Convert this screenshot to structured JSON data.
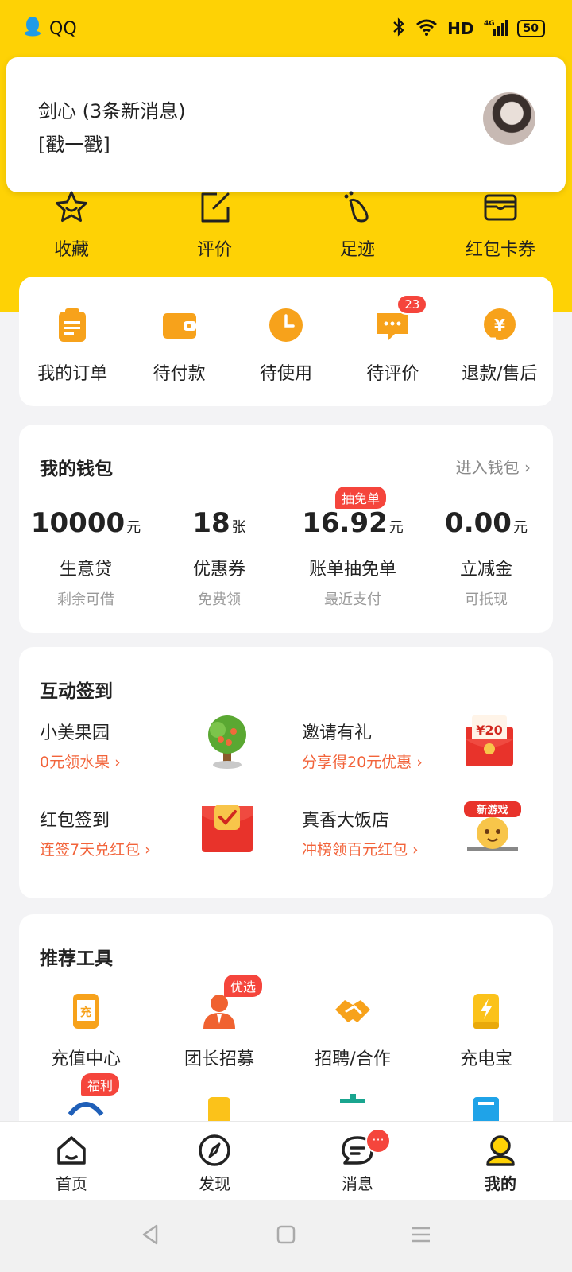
{
  "status_bar": {
    "app": "QQ",
    "network": "HD",
    "signal": "4G",
    "battery": "50"
  },
  "notification": {
    "title": "剑心 (3条新消息)",
    "body": "[戳一戳]"
  },
  "quick_actions": [
    {
      "label": "收藏",
      "icon": "star-icon"
    },
    {
      "label": "评价",
      "icon": "edit-icon"
    },
    {
      "label": "足迹",
      "icon": "footprint-icon"
    },
    {
      "label": "红包卡券",
      "icon": "wallet-card-icon"
    }
  ],
  "orders": [
    {
      "label": "我的订单",
      "icon": "clipboard-icon"
    },
    {
      "label": "待付款",
      "icon": "wallet-icon"
    },
    {
      "label": "待使用",
      "icon": "clock-icon"
    },
    {
      "label": "待评价",
      "icon": "chat-bubble-icon",
      "badge": "23"
    },
    {
      "label": "退款/售后",
      "icon": "refund-icon"
    }
  ],
  "wallet": {
    "title": "我的钱包",
    "link": "进入钱包",
    "items": [
      {
        "value": "10000",
        "unit": "元",
        "name": "生意贷",
        "sub": "剩余可借"
      },
      {
        "value": "18",
        "unit": "张",
        "name": "优惠券",
        "sub": "免费领"
      },
      {
        "value": "16.92",
        "unit": "元",
        "name": "账单抽免单",
        "sub": "最近支付",
        "tag": "抽免单"
      },
      {
        "value": "0.00",
        "unit": "元",
        "name": "立减金",
        "sub": "可抵现"
      }
    ]
  },
  "interactive": {
    "title": "互动签到",
    "items": [
      {
        "title": "小美果园",
        "sub": "0元领水果 ›",
        "icon": "fruit-tree-icon"
      },
      {
        "title": "邀请有礼",
        "sub": "分享得20元优惠 ›",
        "icon": "red-envelope-20-icon",
        "badge_text": "¥20"
      },
      {
        "title": "红包签到",
        "sub": "连签7天兑红包 ›",
        "icon": "red-envelope-check-icon"
      },
      {
        "title": "真香大饭店",
        "sub": "冲榜领百元红包 ›",
        "icon": "new-game-icon",
        "badge_text": "新游戏"
      }
    ]
  },
  "tools": {
    "title": "推荐工具",
    "items": [
      {
        "label": "充值中心",
        "icon": "recharge-icon",
        "glyph": "充"
      },
      {
        "label": "团长招募",
        "icon": "leader-icon",
        "badge": "优选"
      },
      {
        "label": "招聘/合作",
        "icon": "handshake-icon"
      },
      {
        "label": "充电宝",
        "icon": "power-bank-icon"
      }
    ],
    "row2_badge": "福利"
  },
  "bottom_nav": [
    {
      "label": "首页",
      "icon": "home-icon"
    },
    {
      "label": "发现",
      "icon": "compass-icon"
    },
    {
      "label": "消息",
      "icon": "message-icon",
      "dot": "···"
    },
    {
      "label": "我的",
      "icon": "profile-icon",
      "active": true
    }
  ],
  "colors": {
    "brand_yellow": "#fed205",
    "accent_orange": "#f7a21b",
    "badge_red": "#f5453c",
    "link_orange": "#f2633a"
  }
}
